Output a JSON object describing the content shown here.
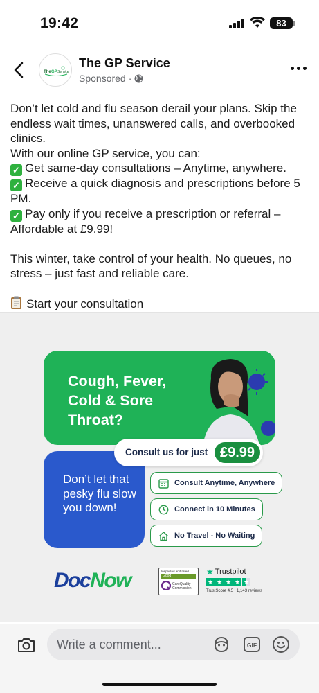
{
  "status_bar": {
    "time": "19:42",
    "battery": "83"
  },
  "post": {
    "page_name": "The GP Service",
    "sponsored_label": "Sponsored",
    "avatar_text": "The GP Service",
    "caption": {
      "intro": "Don’t let cold and flu season derail your plans. Skip the endless wait times, unanswered calls, and overbooked clinics.",
      "lead": "With our online GP service, you can:",
      "bullets": [
        "Get same-day consultations – Anytime, anywhere.",
        "Receive a quick diagnosis and prescriptions before 5 PM.",
        "Pay only if you receive a prescription or referral – Affordable at £9.99!"
      ],
      "closing": "This winter, take control of your health. No queues, no stress – just fast and reliable care.",
      "cta": "Start your consultation"
    }
  },
  "ad": {
    "headline": "Cough, Fever, Cold & Sore Throat?",
    "price_label": "Consult us for just",
    "price": "£9.99",
    "tagline": "Don’t let that pesky flu slow you down!",
    "features": [
      {
        "icon": "calendar-icon",
        "label": "Consult Anytime, Anywhere"
      },
      {
        "icon": "clock-icon",
        "label": "Connect in 10 Minutes"
      },
      {
        "icon": "home-icon",
        "label": "No Travel - No Waiting"
      }
    ],
    "brand": {
      "part1": "Doc",
      "part2": "Now"
    },
    "cqc": {
      "top": "Inspected and rated",
      "rating": "Good",
      "name": "CareQuality Commission"
    },
    "trustpilot": {
      "name": "Trustpilot",
      "score": "TrustScore 4.5 | 1,143 reviews"
    },
    "colors": {
      "green": "#1fb257",
      "blue": "#2a59cc",
      "dark_green": "#1a8f3f"
    }
  },
  "comment_bar": {
    "placeholder": "Write a comment..."
  }
}
